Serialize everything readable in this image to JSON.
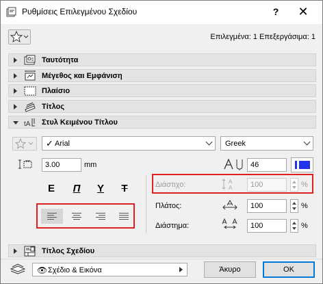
{
  "window": {
    "title": "Ρυθμίσεις Επιλεγμένου Σχεδίου",
    "help_label": "?",
    "close_label": "✕"
  },
  "header": {
    "selection_info": "Επιλεγμένα: 1 Επεξεργάσιμα: 1"
  },
  "panels": [
    {
      "label": "Ταυτότητα",
      "icon": "id-card-icon",
      "expanded": false
    },
    {
      "label": "Μέγεθος και Εμφάνιση",
      "icon": "size-appearance-icon",
      "expanded": false
    },
    {
      "label": "Πλαίσιο",
      "icon": "frame-icon",
      "expanded": false
    },
    {
      "label": "Τίτλος",
      "icon": "title-icon",
      "expanded": false
    },
    {
      "label": "Στυλ Κειμένου Τίτλου",
      "icon": "text-style-icon",
      "expanded": true
    }
  ],
  "text_style": {
    "font": "Arial",
    "script": "Greek",
    "size": "3.00",
    "size_unit": "mm",
    "pen": "46",
    "pen_color": "#2233ee",
    "style_buttons": [
      {
        "label": "E",
        "name": "bold-button"
      },
      {
        "label": "Π",
        "name": "italic-button"
      },
      {
        "label": "Υ",
        "name": "underline-button"
      },
      {
        "label": "Τ",
        "name": "strikethrough-button"
      }
    ],
    "alignments": [
      {
        "name": "align-left-button",
        "active": true
      },
      {
        "name": "align-center-button",
        "active": false
      },
      {
        "name": "align-right-button",
        "active": false
      },
      {
        "name": "align-justify-button",
        "active": false
      }
    ],
    "spacing": {
      "label": "Διάστιχο:",
      "value": "100",
      "unit": "%",
      "enabled": false
    },
    "width": {
      "label": "Πλάτος:",
      "value": "100",
      "unit": "%"
    },
    "char_spacing": {
      "label": "Διάστημα:",
      "value": "100",
      "unit": "%"
    }
  },
  "drawing_title_panel": {
    "label": "Τίτλος Σχεδίου",
    "icon": "drawing-title-icon",
    "expanded": false
  },
  "footer": {
    "view_option": "Σχέδιο & Εικόνα",
    "cancel_label": "Άκυρο",
    "ok_label": "OK"
  }
}
